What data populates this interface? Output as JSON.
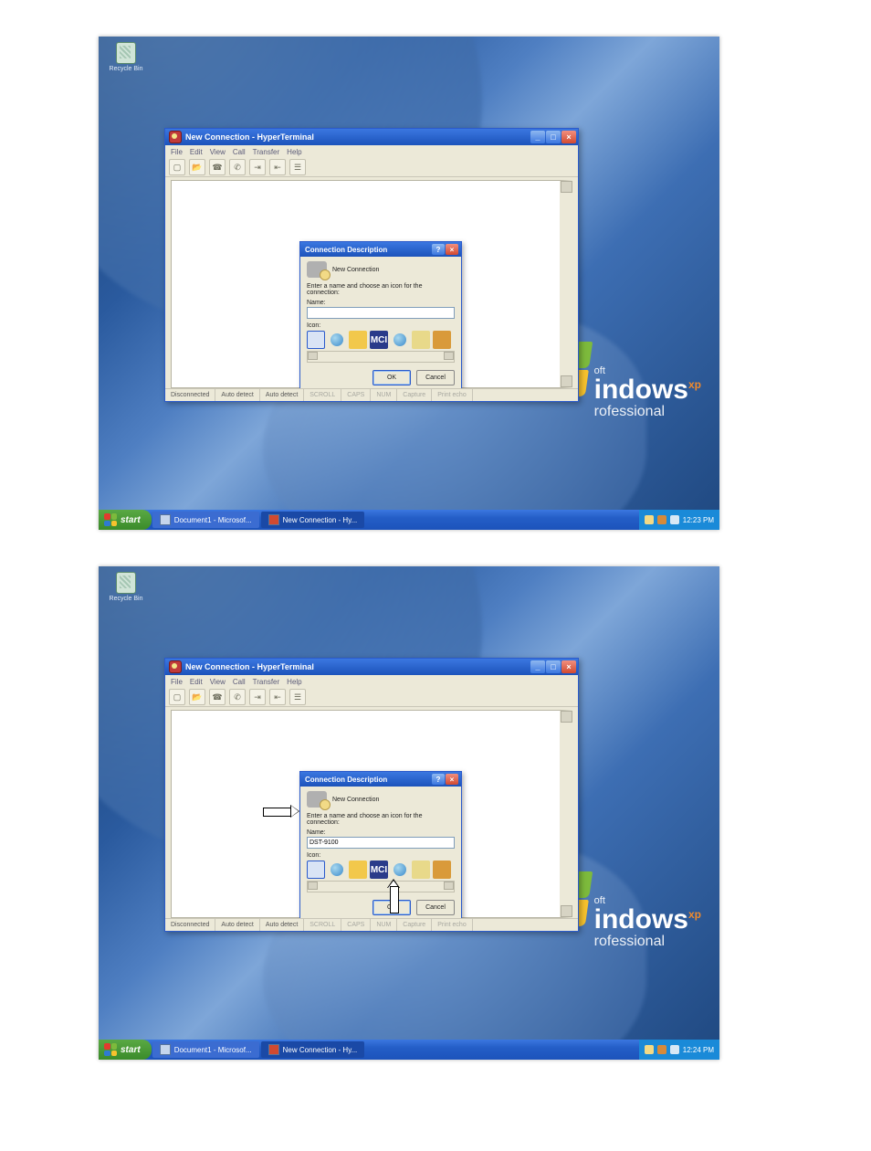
{
  "desktop_icon": {
    "label": "Recycle Bin"
  },
  "xp_logo": {
    "line1": "oft",
    "line2": "indows",
    "sup": "xp",
    "line3": "rofessional"
  },
  "taskbar": {
    "start": "start",
    "items": [
      {
        "label": "Document1 - Microsof..."
      },
      {
        "label": "New Connection - Hy..."
      }
    ],
    "time1": "12:23 PM",
    "time2": "12:24 PM"
  },
  "appwin": {
    "title": "New Connection - HyperTerminal",
    "menu": [
      "File",
      "Edit",
      "View",
      "Call",
      "Transfer",
      "Help"
    ],
    "status": {
      "conn": "Disconnected",
      "det1": "Auto detect",
      "det2": "Auto detect",
      "scroll": "SCROLL",
      "caps": "CAPS",
      "num": "NUM",
      "capture": "Capture",
      "echo": "Print echo"
    }
  },
  "dialog": {
    "title": "Connection Description",
    "subtitle": "New Connection",
    "instruction": "Enter a name and choose an icon for the connection:",
    "name_label": "Name:",
    "icon_label": "Icon:",
    "ok": "OK",
    "cancel": "Cancel",
    "name_value_1": "",
    "name_value_2": "DST-9100"
  }
}
